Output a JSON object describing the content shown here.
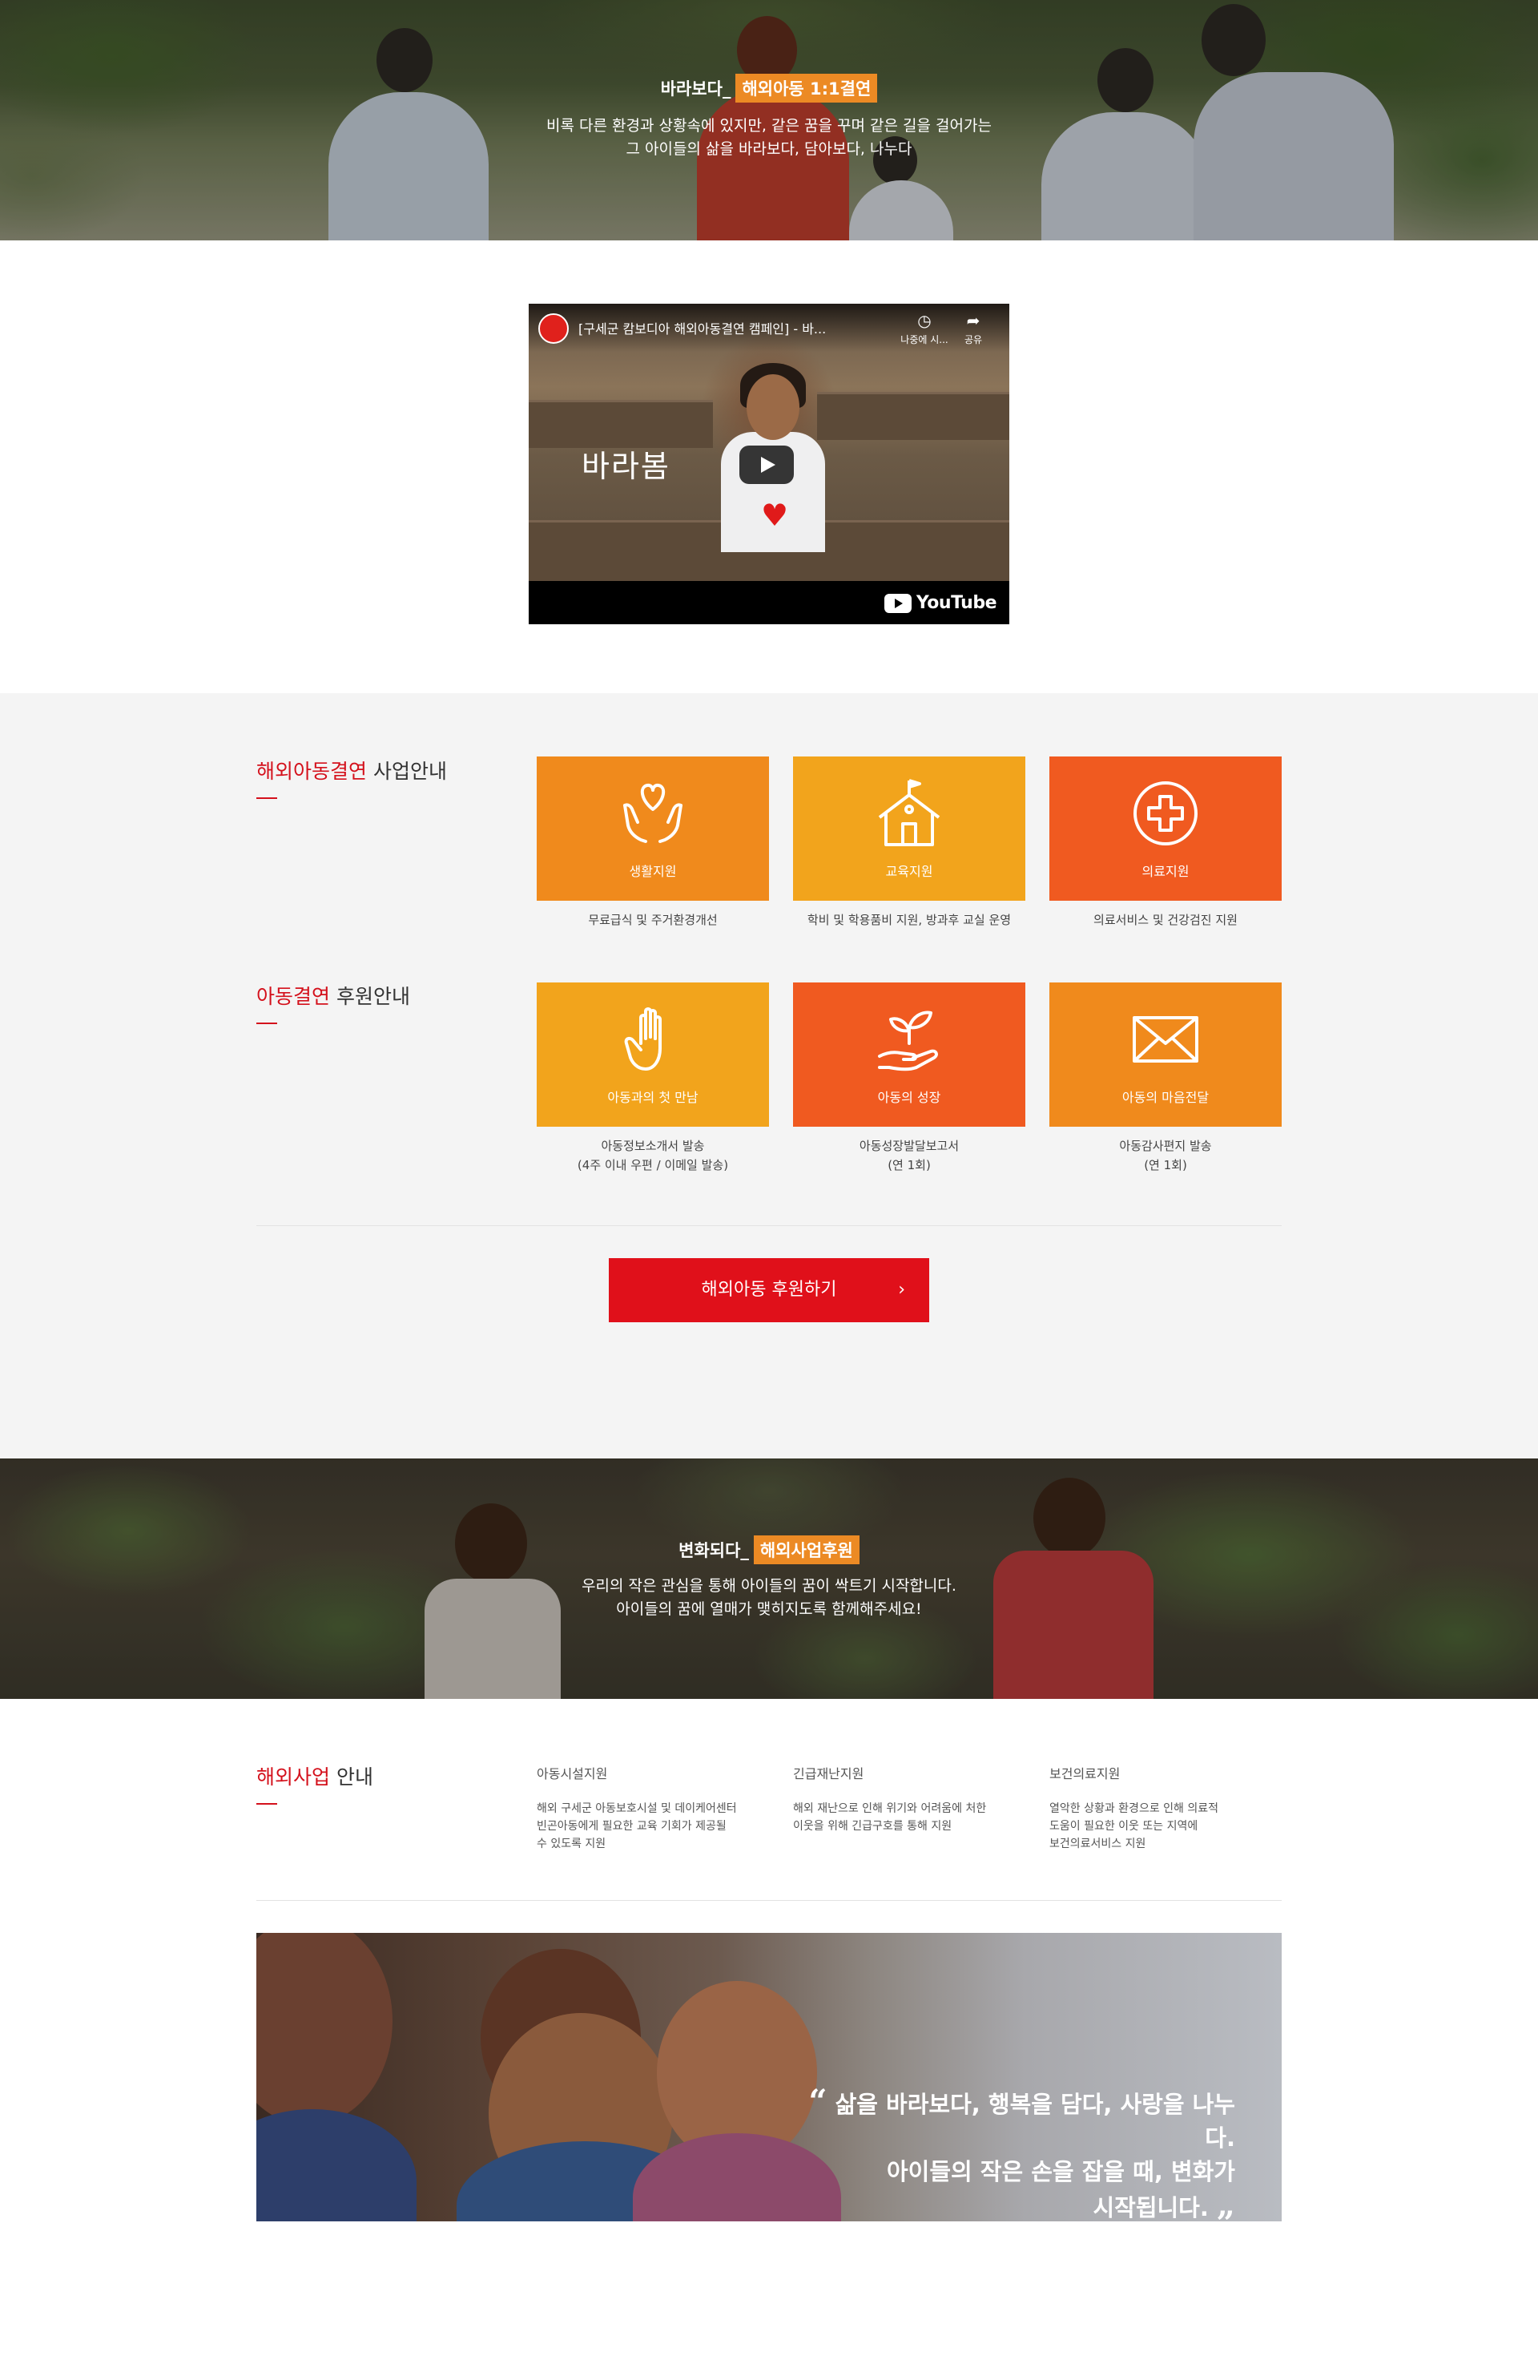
{
  "hero_top": {
    "prefix": "바라보다_",
    "tag": "해외아동 1:1결연",
    "line1": "비록 다른 환경과 상황속에 있지만, 같은 꿈을 꾸며 같은 길을 걸어가는",
    "line2": "그 아이들의 삶을 바라보다, 담아보다, 나누다"
  },
  "video": {
    "title": "[구세군 캄보디아 해외아동결연 캠페인] - 바...",
    "watch_later": "나중에 시...",
    "share": "공유",
    "handwriting": "바라봄",
    "youtube": "YouTube"
  },
  "business": {
    "title_red": "해외아동결연",
    "title_rest": " 사업안내",
    "cards": [
      {
        "label": "생활지원",
        "desc": "무료급식 및 주거환경개선",
        "color": "#f08a1c",
        "icon": "hands-heart-icon"
      },
      {
        "label": "교육지원",
        "desc": "학비 및 학용품비 지원, 방과후 교실 운영",
        "color": "#f2a41c",
        "icon": "school-icon"
      },
      {
        "label": "의료지원",
        "desc": "의료서비스 및 건강검진 지원",
        "color": "#f05a20",
        "icon": "medical-cross-icon"
      }
    ]
  },
  "sponsor": {
    "title_red": "아동결연",
    "title_rest": " 후원안내",
    "cards": [
      {
        "label": "아동과의 첫 만남",
        "desc1": "아동정보소개서 발송",
        "desc2": "(4주 이내 우편 / 이메일 발송)",
        "color": "#f2a41c",
        "icon": "hand-icon"
      },
      {
        "label": "아동의 성장",
        "desc1": "아동성장발달보고서",
        "desc2": "(연 1회)",
        "color": "#f05a20",
        "icon": "sprout-icon"
      },
      {
        "label": "아동의 마음전달",
        "desc1": "아동감사편지 발송",
        "desc2": "(연 1회)",
        "color": "#f08a1c",
        "icon": "envelope-icon"
      }
    ]
  },
  "cta": {
    "label": "해외아동 후원하기",
    "arrow": "›"
  },
  "hero_mid": {
    "prefix": "변화되다_",
    "tag": "해외사업후원",
    "line1": "우리의 작은 관심을 통해 아이들의 꿈이 싹트기 시작합니다.",
    "line2": "아이들의 꿈에 열매가 맺히지도록 함께해주세요!"
  },
  "projects": {
    "title_red": "해외사업",
    "title_rest": " 안내",
    "items": [
      {
        "title": "아동시설지원",
        "l1": "해외 구세군 아동보호시설 및 데이케어센터",
        "l2": "빈곤아동에게 필요한 교육 기회가 제공될",
        "l3": "수 있도록 지원"
      },
      {
        "title": "긴급재난지원",
        "l1": "해외 재난으로 인해 위기와 어려움에 처한",
        "l2": "이웃을 위해 긴급구호를 통해 지원",
        "l3": ""
      },
      {
        "title": "보건의료지원",
        "l1": "열악한 상황과 환경으로 인해 의료적",
        "l2": "도움이 필요한 이웃 또는 지역에",
        "l3": "보건의료서비스 지원"
      }
    ]
  },
  "banner": {
    "open_quote": "“",
    "line1": "삶을 바라보다, 행복을 담다, 사랑을 나누다.",
    "line2": "아이들의 작은 손을 잡을 때, 변화가",
    "line3": "시작됩니다.",
    "close_quote": "„"
  },
  "colors": {
    "accent_red": "#d4111c",
    "cta_red": "#e0101a",
    "tag_orange": "#ec8a24",
    "card_orange": "#f08a1c",
    "card_yellow": "#f2a41c",
    "card_red": "#f05a20"
  }
}
